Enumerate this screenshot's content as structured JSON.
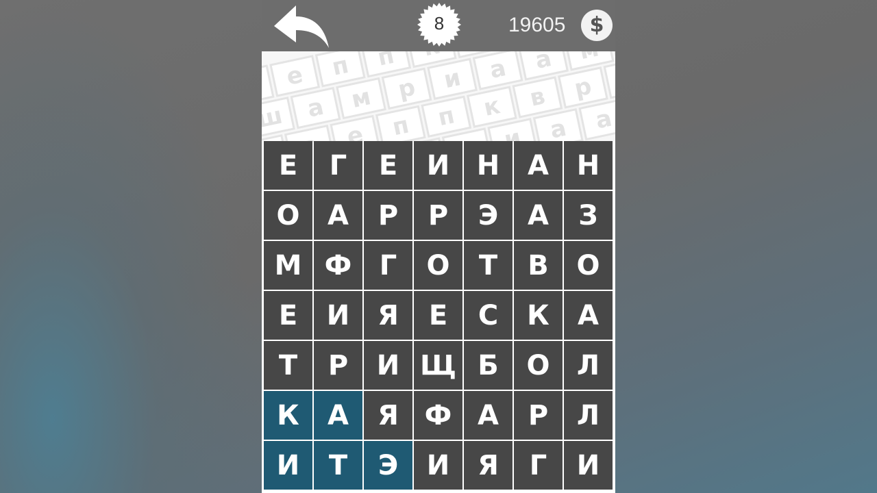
{
  "header": {
    "level": "8",
    "coins": "19605",
    "coin_symbol": "$"
  },
  "colors": {
    "cell": "#474747",
    "cell_selected": "#1f5a73",
    "topbar": "#6d6d6d"
  },
  "grid": [
    [
      "Е",
      "Г",
      "Е",
      "И",
      "Н",
      "А",
      "Н"
    ],
    [
      "О",
      "А",
      "Р",
      "Р",
      "Э",
      "А",
      "З"
    ],
    [
      "М",
      "Ф",
      "Г",
      "О",
      "Т",
      "В",
      "О"
    ],
    [
      "Е",
      "И",
      "Я",
      "Е",
      "С",
      "К",
      "А"
    ],
    [
      "Т",
      "Р",
      "И",
      "Щ",
      "Б",
      "О",
      "Л"
    ],
    [
      "К",
      "А",
      "Я",
      "Ф",
      "А",
      "Р",
      "Л"
    ],
    [
      "И",
      "Т",
      "Э",
      "И",
      "Я",
      "Г",
      "И"
    ]
  ],
  "selected": [
    [
      5,
      0
    ],
    [
      5,
      1
    ],
    [
      6,
      0
    ],
    [
      6,
      1
    ],
    [
      6,
      2
    ]
  ],
  "decor_letters": [
    "в",
    "е",
    "п",
    "п",
    "к",
    "в",
    "р",
    "а",
    "м",
    "ш",
    "а",
    "м",
    "р",
    "и",
    "а",
    "а",
    "м",
    "в",
    "и"
  ]
}
